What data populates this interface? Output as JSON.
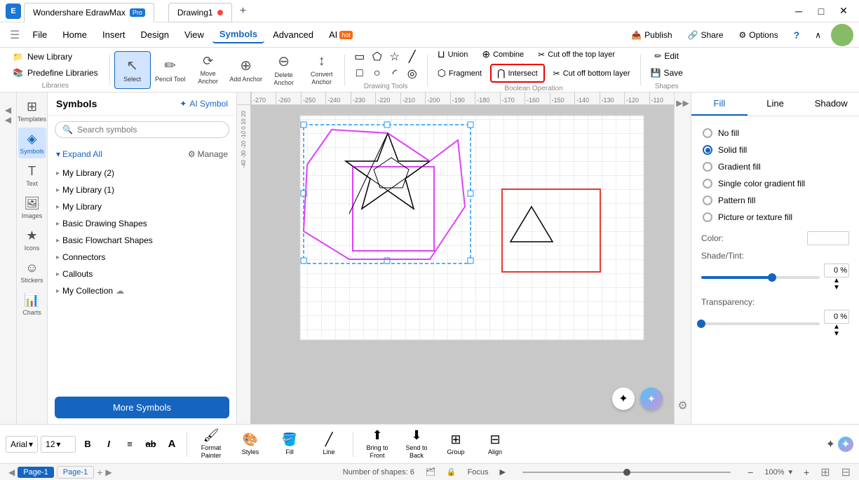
{
  "app": {
    "name": "Wondershare EdrawMax",
    "badge": "Pro",
    "tab1": "Drawing1",
    "tab_dot_color": "#f44336"
  },
  "menubar": {
    "items": [
      "File",
      "Home",
      "Insert",
      "Design",
      "View",
      "Symbols",
      "Advanced",
      "AI"
    ],
    "active": "Symbols",
    "ai_badge": "hot",
    "right": [
      "Publish",
      "Share",
      "Options"
    ]
  },
  "toolbar": {
    "select_label": "Select",
    "pencil_tool_label": "Pencil Tool",
    "move_anchor_label": "Move Anchor",
    "add_anchor_label": "Add Anchor",
    "delete_anchor_label": "Delete Anchor",
    "convert_anchor_label": "Convert Anchor",
    "drawing_tools_label": "Drawing Tools",
    "union_label": "Union",
    "combine_label": "Combine",
    "cut_off_top_label": "Cut off the top layer",
    "fragment_label": "Fragment",
    "intersect_label": "Intersect",
    "cut_off_bottom_label": "Cut off bottom layer",
    "boolean_label": "Boolean Operation",
    "edit_label": "Edit",
    "save_label": "Save",
    "shapes_label": "Shapes"
  },
  "symbols_panel": {
    "title": "Symbols",
    "ai_symbol": "AI Symbol",
    "search_placeholder": "Search symbols",
    "expand_all": "Expand All",
    "manage": "Manage",
    "tree_items": [
      "My Library (2)",
      "My Library (1)",
      "My Library",
      "Basic Drawing Shapes",
      "Basic Flowchart Shapes",
      "Connectors",
      "Callouts",
      "My Collection"
    ],
    "more_symbols_btn": "More Symbols"
  },
  "right_panel": {
    "tabs": [
      "Fill",
      "Line",
      "Shadow"
    ],
    "active_tab": "Fill",
    "fill_options": [
      {
        "label": "No fill",
        "checked": false
      },
      {
        "label": "Solid fill",
        "checked": true
      },
      {
        "label": "Gradient fill",
        "checked": false
      },
      {
        "label": "Single color gradient fill",
        "checked": false
      },
      {
        "label": "Pattern fill",
        "checked": false
      },
      {
        "label": "Picture or texture fill",
        "checked": false
      }
    ],
    "color_label": "Color:",
    "shade_tint_label": "Shade/Tint:",
    "shade_value": "0 %",
    "transparency_label": "Transparency:",
    "transparency_value": "0 %"
  },
  "bottom_toolbar": {
    "font": "Arial",
    "font_size": "12",
    "bold": "B",
    "italic": "I",
    "align": "≡",
    "strikethrough": "ab",
    "text_size_A": "A",
    "format_painter_label": "Format Painter",
    "styles_label": "Styles",
    "fill_label": "Fill",
    "line_label": "Line",
    "bring_to_front_label": "Bring to Front",
    "send_to_back_label": "Send to Back",
    "group_label": "Group",
    "align_label": "Align"
  },
  "statusbar": {
    "page_label": "Page-1",
    "shapes_count": "Number of shapes: 6",
    "focus_label": "Focus",
    "zoom_level": "100%"
  },
  "icons": {
    "search": "🔍",
    "arrow_down": "▾",
    "arrow_right": "▸",
    "collapse": "◀◀",
    "expand": "▶▶",
    "star": "✦",
    "diamond": "◆",
    "settings": "⚙",
    "plus": "+",
    "minus": "−",
    "publish": "📤",
    "share": "🔗",
    "options": "⚙",
    "help": "?",
    "chevron_up": "∧"
  }
}
